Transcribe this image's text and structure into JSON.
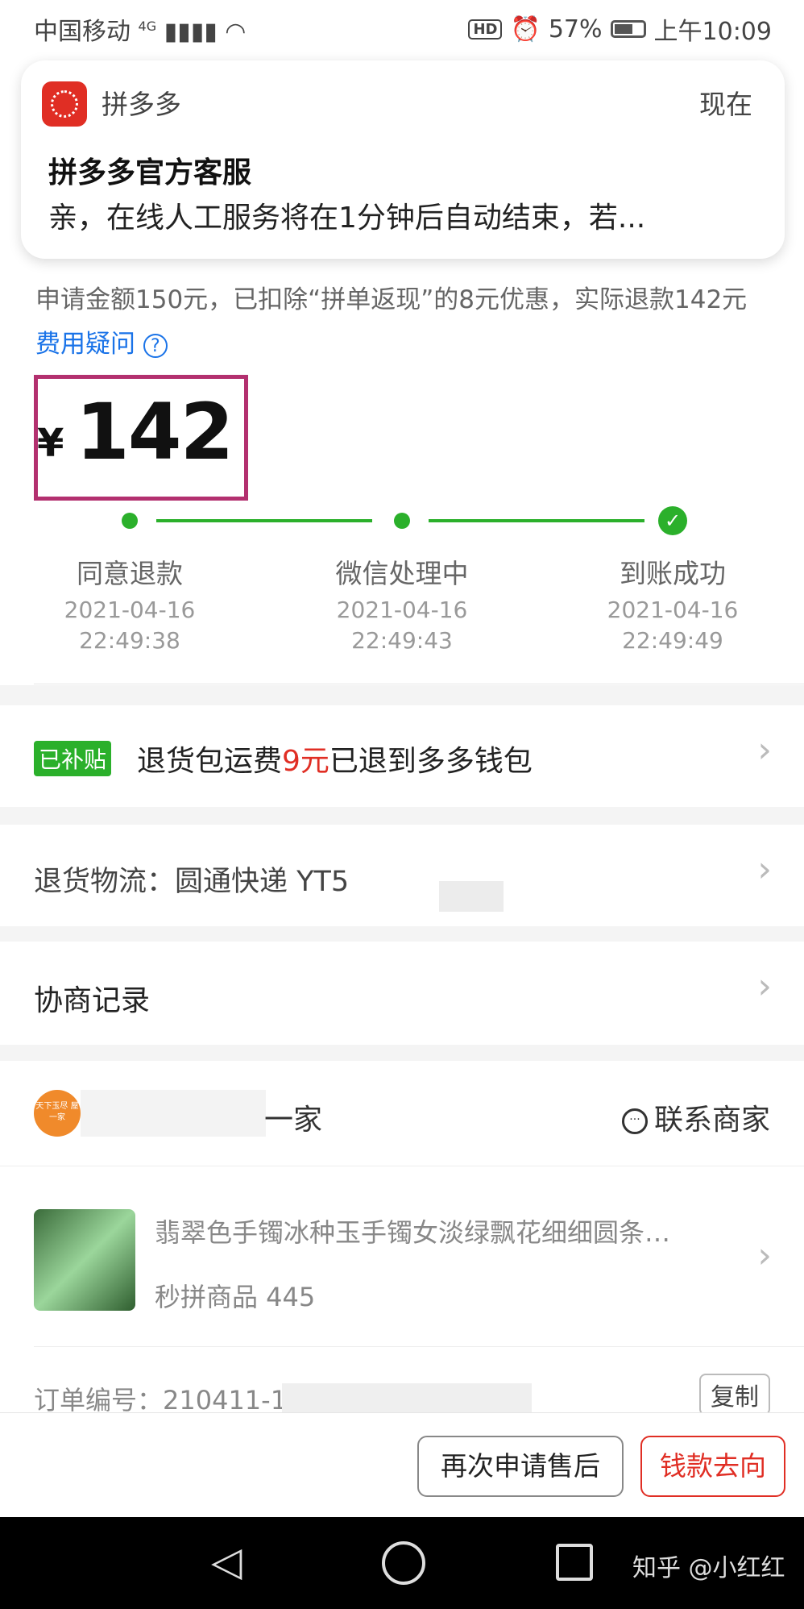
{
  "status_bar": {
    "carrier": "中国移动",
    "network": "4G",
    "hd": "HD",
    "battery": "57%",
    "time": "上午10:09"
  },
  "notification": {
    "app_name": "拼多多",
    "time": "现在",
    "title": "拼多多官方客服",
    "body": "亲，在线人工服务将在1分钟后自动结束，若..."
  },
  "refund": {
    "info_text": "申请金额150元，已扣除“拼单返现”的8元优惠，实际退款142元",
    "fee_link": "费用疑问",
    "currency": "¥",
    "amount": "142"
  },
  "progress": {
    "steps": [
      {
        "label": "同意退款",
        "date": "2021-04-16",
        "time": "22:49:38"
      },
      {
        "label": "微信处理中",
        "date": "2021-04-16",
        "time": "22:49:43"
      },
      {
        "label": "到账成功",
        "date": "2021-04-16",
        "time": "22:49:49"
      }
    ]
  },
  "subsidy": {
    "badge": "已补贴",
    "text_before": "退货包运费",
    "amount": "9元",
    "text_after": "已退到多多钱包"
  },
  "logistics": {
    "label": "退货物流：圆通快递 YT5"
  },
  "negotiation": {
    "label": "协商记录"
  },
  "shop": {
    "avatar_text": "天下玉尽 屋一家",
    "name_suffix": "一家",
    "contact_label": "联系商家"
  },
  "product": {
    "title": "翡翠色手镯冰种玉手镯女淡绿飘花细细圆条…",
    "subtitle": "秒拼商品 445"
  },
  "order": {
    "label": "订单编号：210411-1",
    "copy_label": "复制"
  },
  "actions": {
    "reapply_label": "再次申请售后",
    "money_flow_label": "钱款去向"
  },
  "watermark": "知乎 @小红红",
  "colors": {
    "brand_red": "#e02e24",
    "success_green": "#2bb02b",
    "link_blue": "#1a73e8",
    "highlight_box": "#b3306f"
  }
}
